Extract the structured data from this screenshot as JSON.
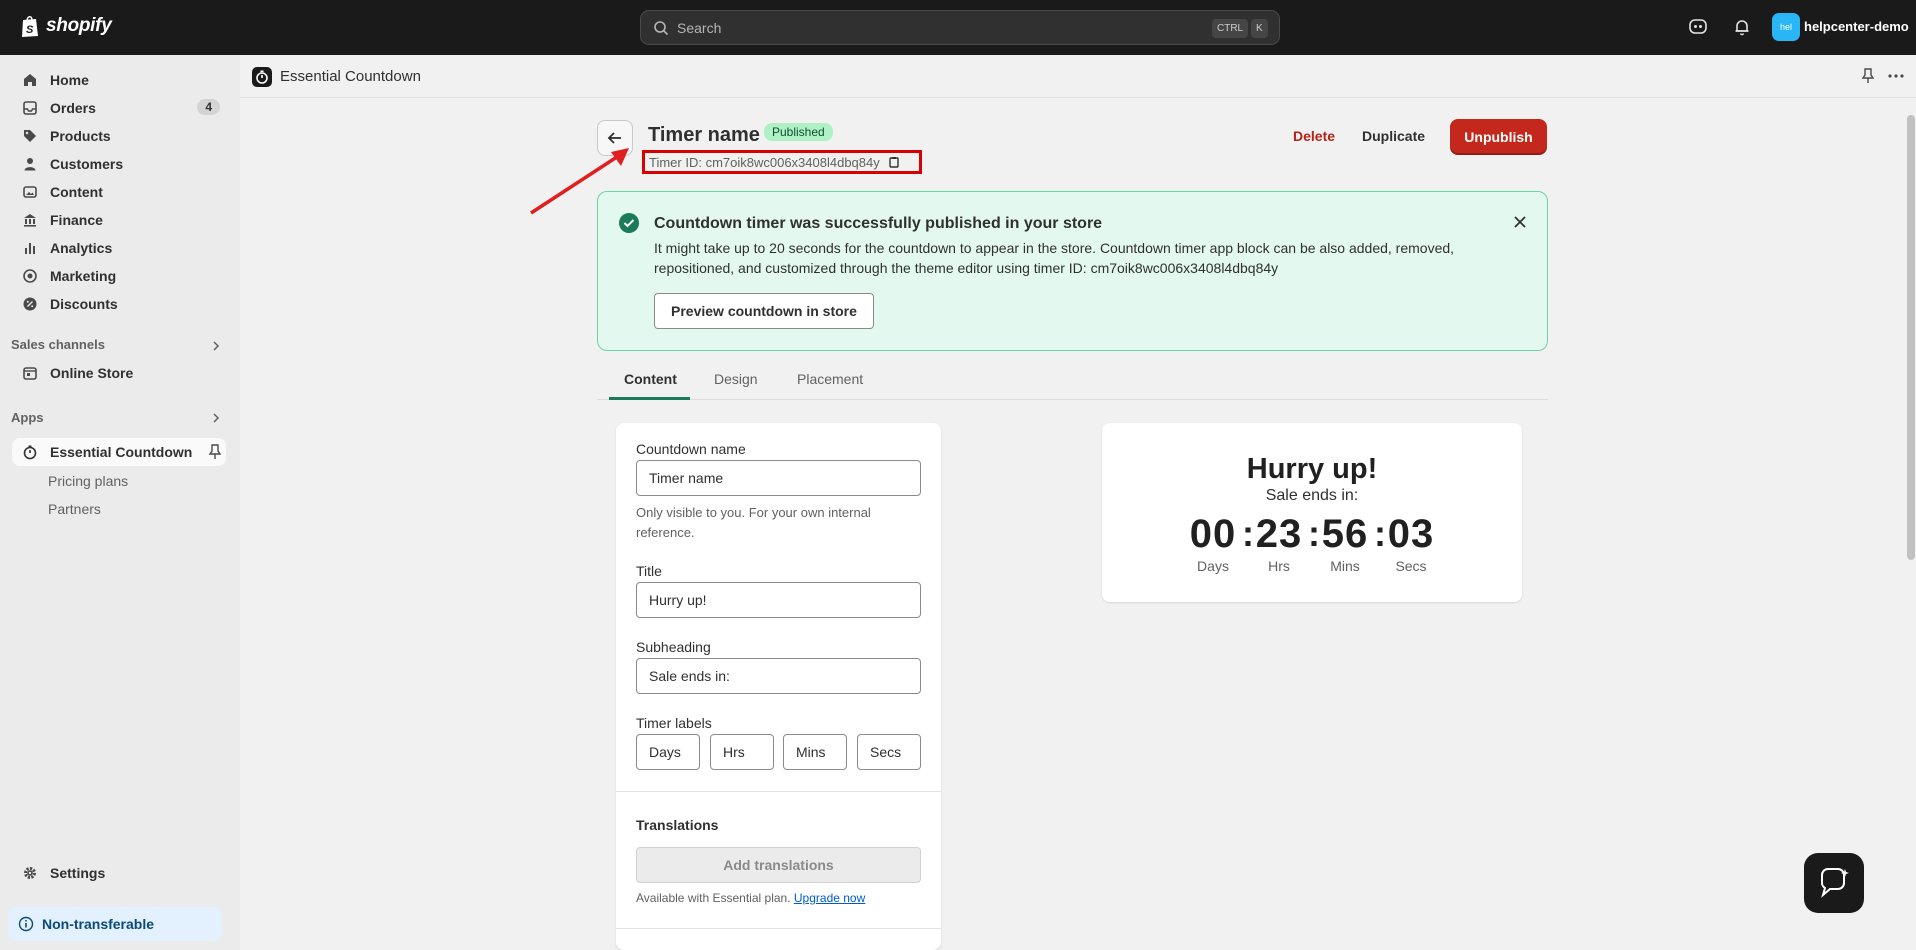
{
  "topbar": {
    "logo_text": "shopify",
    "search_placeholder": "Search",
    "kbd_ctrl": "CTRL",
    "kbd_k": "K",
    "store_avatar": "hel",
    "store_name": "helpcenter-demo"
  },
  "sidebar": {
    "items": [
      {
        "label": "Home",
        "icon": "home-icon"
      },
      {
        "label": "Orders",
        "icon": "inbox-icon",
        "badge": "4"
      },
      {
        "label": "Products",
        "icon": "tag-icon"
      },
      {
        "label": "Customers",
        "icon": "person-icon"
      },
      {
        "label": "Content",
        "icon": "image-icon"
      },
      {
        "label": "Finance",
        "icon": "bank-icon"
      },
      {
        "label": "Analytics",
        "icon": "bar-chart-icon"
      },
      {
        "label": "Marketing",
        "icon": "target-icon"
      },
      {
        "label": "Discounts",
        "icon": "discount-icon"
      }
    ],
    "sales_channels_label": "Sales channels",
    "online_store": "Online Store",
    "apps_label": "Apps",
    "app_active": "Essential Countdown",
    "app_sub": [
      "Pricing plans",
      "Partners"
    ],
    "settings": "Settings",
    "non_transferable": "Non-transferable"
  },
  "appbar": {
    "title": "Essential Countdown"
  },
  "page": {
    "title": "Timer name",
    "status": "Published",
    "timer_id": "Timer ID: cm7oik8wc006x3408l4dbq84y",
    "delete": "Delete",
    "duplicate": "Duplicate",
    "unpublish": "Unpublish"
  },
  "banner": {
    "title": "Countdown timer was successfully published in your store",
    "text": "It might take up to 20 seconds for the countdown to appear in the store. Countdown timer app block can be also added, removed, repositioned, and customized through the theme editor using timer ID: cm7oik8wc006x3408l4dbq84y",
    "button": "Preview countdown in store"
  },
  "tabs": [
    "Content",
    "Design",
    "Placement"
  ],
  "form": {
    "name_label": "Countdown name",
    "name_value": "Timer name",
    "name_help": "Only visible to you. For your own internal reference.",
    "title_label": "Title",
    "title_value": "Hurry up!",
    "subheading_label": "Subheading",
    "subheading_value": "Sale ends in:",
    "timer_labels_label": "Timer labels",
    "timer_labels": [
      "Days",
      "Hrs",
      "Mins",
      "Secs"
    ],
    "translations_heading": "Translations",
    "add_translations": "Add translations",
    "plan_note": "Available with Essential plan.",
    "upgrade_link": "Upgrade now"
  },
  "preview": {
    "title": "Hurry up!",
    "subtitle": "Sale ends in:",
    "units": [
      {
        "value": "00",
        "label": "Days"
      },
      {
        "value": "23",
        "label": "Hrs"
      },
      {
        "value": "56",
        "label": "Mins"
      },
      {
        "value": "03",
        "label": "Secs"
      }
    ]
  },
  "colors": {
    "topbar": "#1a1a1a",
    "success_bg": "#e3f9ef",
    "unpublish": "#c4281c",
    "annotation": "#d80000"
  }
}
